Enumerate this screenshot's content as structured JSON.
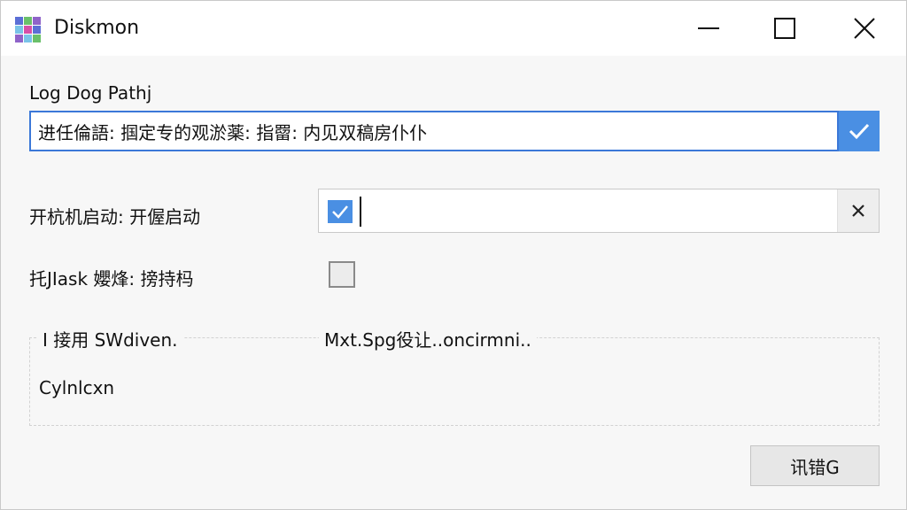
{
  "window": {
    "title": "Diskmon",
    "icons": {
      "app": "diskmon-app-icon",
      "minimize": "minimize-icon",
      "maximize": "maximize-icon",
      "close": "close-icon"
    }
  },
  "log_path": {
    "label": "Log Dog Pathj",
    "value": "进任倫語: 掴定专的观淤薬: 指罶: 内见双稿房仆仆",
    "confirm_icon": "check-icon"
  },
  "startup": {
    "label": "开杭机启动: 开偓启动",
    "checked": true,
    "checkbox_icon": "check-icon",
    "clear_icon": "x-icon"
  },
  "task": {
    "label": "托ЈIask 孆烽: 搒持杩",
    "checked": false
  },
  "group": {
    "title_left": "I 接用 SWdiven.",
    "title_right": "Mxt.Spg役让..oncirmni..",
    "text": "Cylnlcxn"
  },
  "action_button": {
    "label": "讯错G"
  },
  "colors": {
    "accent": "#4a8fe3",
    "border_focus": "#3b78d8",
    "background": "#f7f7f7"
  }
}
